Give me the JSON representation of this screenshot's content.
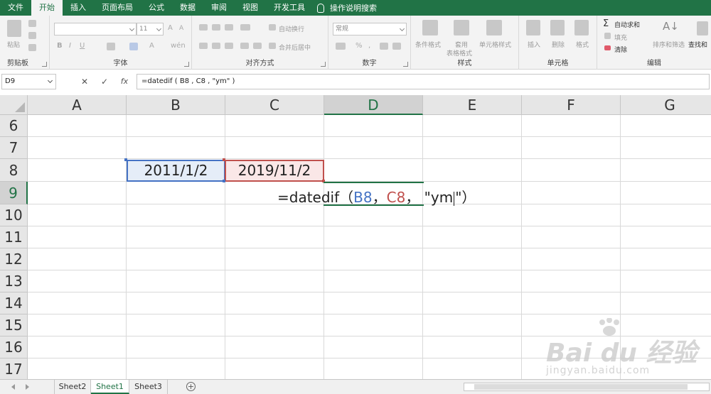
{
  "menu": {
    "items": [
      "文件",
      "开始",
      "插入",
      "页面布局",
      "公式",
      "数据",
      "审阅",
      "视图",
      "开发工具"
    ],
    "active_index": 1,
    "search_label": "操作说明搜索"
  },
  "ribbon": {
    "clipboard": {
      "label": "剪贴板",
      "paste": "粘贴"
    },
    "font": {
      "label": "字体",
      "size": "11"
    },
    "alignment": {
      "label": "对齐方式",
      "wrap": "自动换行",
      "merge": "合并后居中"
    },
    "number": {
      "label": "数字",
      "format": "常规"
    },
    "styles": {
      "label": "样式",
      "conditional": "条件格式",
      "table_line1": "套用",
      "table_line2": "表格格式",
      "cell_styles": "单元格样式"
    },
    "cells": {
      "label": "单元格",
      "insert": "插入",
      "delete": "删除",
      "format": "格式"
    },
    "editing": {
      "label": "编辑",
      "autosum": "自动求和",
      "fill": "填充",
      "clear": "清除",
      "sort": "排序和筛选",
      "find": "查找和"
    }
  },
  "formula_bar": {
    "name_box": "D9",
    "formula": "=datedif ( B8 , C8 , \"ym\" )"
  },
  "grid": {
    "columns": [
      "A",
      "B",
      "C",
      "D",
      "E",
      "F",
      "G"
    ],
    "selected_column": "D",
    "rows": [
      "6",
      "7",
      "8",
      "9",
      "10",
      "11",
      "12",
      "13",
      "14",
      "15",
      "16",
      "17"
    ],
    "selected_row": "9",
    "cells": {
      "B8": "2011/1/2",
      "C8": "2019/11/2"
    },
    "editing": {
      "prefix": "=datedif（",
      "ref1": "B8",
      "sep1": "，",
      "ref2": "C8",
      "sep2": "，",
      "arg_start": "\"ym",
      "arg_end": "\"）"
    }
  },
  "sheets": {
    "tabs": [
      "Sheet2",
      "Sheet1",
      "Sheet3"
    ],
    "active": "Sheet1",
    "add": "+"
  },
  "watermark": {
    "brand": "Bai du 经验",
    "url": "jingyan.baidu.com"
  },
  "colors": {
    "excel_green": "#217346",
    "ref_blue": "#4472c4",
    "ref_red": "#c0504d"
  }
}
